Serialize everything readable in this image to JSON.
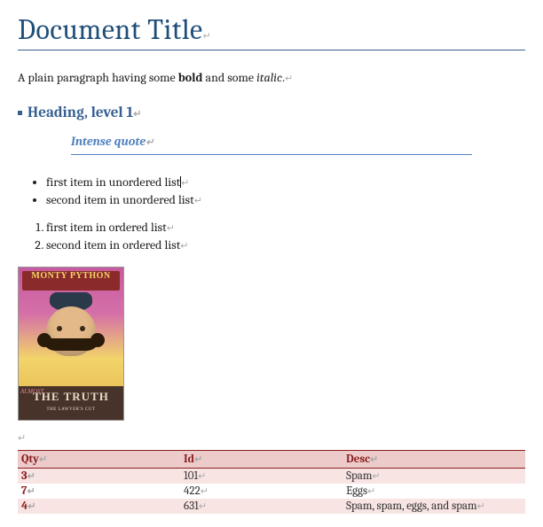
{
  "doc": {
    "title": "Document Title",
    "plain_paragraph": {
      "pre": "A plain paragraph having some ",
      "bold": "bold",
      "mid": " and some ",
      "italic": "italic",
      "post": "."
    },
    "heading1": "Heading, level 1",
    "intense_quote": "Intense quote",
    "ul": [
      "first item in unordered list",
      "second item in unordered list"
    ],
    "ol": [
      "first item in ordered list",
      "second item in ordered list"
    ],
    "image": {
      "banner": "MONTY PYTHON",
      "almost": "ALMOST",
      "truth": "THE TRUTH",
      "sub": "THE LAWYER'S CUT"
    },
    "table": {
      "headers": [
        "Qty",
        "Id",
        "Desc"
      ],
      "rows": [
        [
          "3",
          "101",
          "Spam"
        ],
        [
          "7",
          "422",
          "Eggs"
        ],
        [
          "4",
          "631",
          "Spam, spam, eggs, and spam"
        ]
      ]
    },
    "pil": "↵"
  }
}
